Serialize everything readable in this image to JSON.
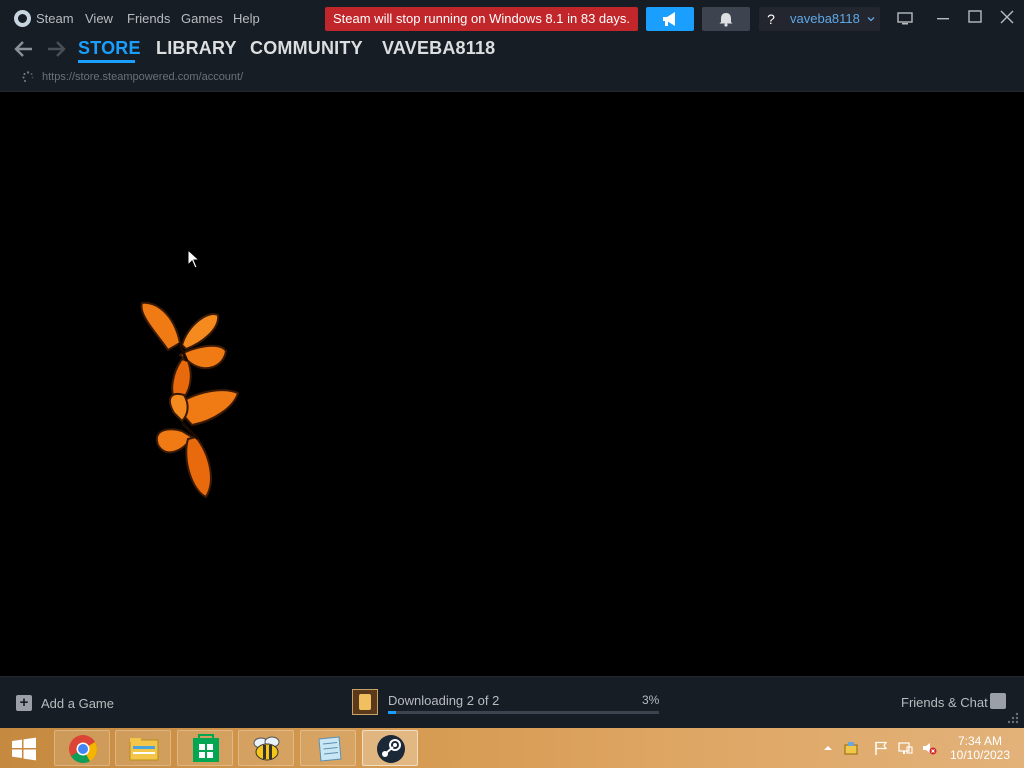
{
  "menu": {
    "items": [
      "Steam",
      "View",
      "Friends",
      "Games",
      "Help"
    ]
  },
  "notice": {
    "text": "Steam will stop running on Windows 8.1 in 83 days."
  },
  "account": {
    "help_label": "?",
    "username": "vaveba8118"
  },
  "nav": {
    "links": [
      "STORE",
      "LIBRARY",
      "COMMUNITY",
      "VAVEBA8118"
    ],
    "active_index": 0
  },
  "url": "https://store.steampowered.com/account/",
  "bottom": {
    "add_game": "Add a Game",
    "download_text": "Downloading 2 of 2",
    "download_percent_label": "3%",
    "download_progress": 0.03,
    "friends_label": "Friends & Chat"
  },
  "taskbar": {
    "apps": [
      "chrome-icon",
      "file-explorer-icon",
      "windows-store-icon",
      "bee-app-icon",
      "notepad-icon",
      "steam-icon"
    ],
    "time": "7:34 AM",
    "date": "10/10/2023"
  },
  "colors": {
    "accent": "#1a9fff",
    "notice": "#c1262a",
    "titlebar": "#171d25",
    "taskbar": "#d69b52"
  }
}
